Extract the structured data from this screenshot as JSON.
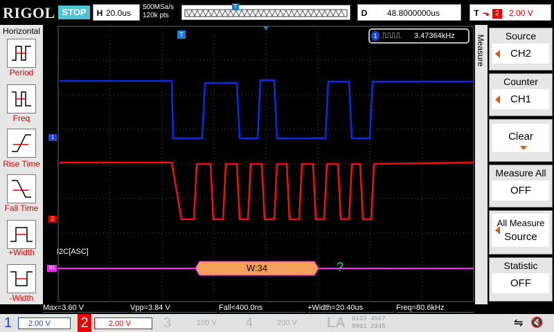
{
  "brand": "RIGOL",
  "run_state": "STOP",
  "horizontal": {
    "letter": "H",
    "timebase": "20.0us",
    "sample_rate": "500MSa/s",
    "memory_depth": "120k pts"
  },
  "delay": {
    "letter": "D",
    "value": "48.8000000us"
  },
  "trigger": {
    "letter": "T",
    "channel": "2",
    "level": "2.00 V"
  },
  "left_menu": {
    "title": "Horizontal",
    "items": [
      {
        "label": "Period",
        "icon": "period-icon"
      },
      {
        "label": "Freq",
        "icon": "freq-icon"
      },
      {
        "label": "Rise Time",
        "icon": "rise-time-icon"
      },
      {
        "label": "Fall Time",
        "icon": "fall-time-icon"
      },
      {
        "label": "+Width",
        "icon": "positive-width-icon"
      },
      {
        "label": "-Width",
        "icon": "negative-width-icon"
      }
    ]
  },
  "counter_readout": {
    "channel": "1",
    "value": "3.47364kHz"
  },
  "markers": {
    "ch1": "1",
    "ch2": "2",
    "bus": "B1",
    "trigger_top": "T",
    "trigger_right": "T"
  },
  "decode": {
    "label": "I2C[ASC]",
    "packet": "W:34",
    "unknown": "?"
  },
  "right_menu": {
    "tab": "Measure",
    "source": {
      "title": "Source",
      "value": "CH2"
    },
    "counter": {
      "title": "Counter",
      "value": "CH1"
    },
    "clear": {
      "title": "Clear"
    },
    "measure_all": {
      "title": "Measure All",
      "value": "OFF"
    },
    "all_measure_source": {
      "title": "All Measure",
      "value": "Source"
    },
    "statistic": {
      "title": "Statistic",
      "value": "OFF"
    }
  },
  "measurements": [
    {
      "text": "Max=3.60 V",
      "color": "#2255ff"
    },
    {
      "text": "Vpp=3.84 V",
      "color": "#2255ff"
    },
    {
      "text": "Fall<400.0ns",
      "color": "#2255ff"
    },
    {
      "text": "+Width=20.40us",
      "color": "#2255ff"
    },
    {
      "text": "Freq=80.6kHz",
      "color": "#ff2222"
    }
  ],
  "channels": [
    {
      "num": "1",
      "scale": "2.00 V",
      "color": "#1a44d8"
    },
    {
      "num": "2",
      "scale": "2.00 V",
      "color": "#e00000"
    },
    {
      "num": "3",
      "scale": "100 V",
      "color": "#bbbbbb"
    },
    {
      "num": "4",
      "scale": "200 V",
      "color": "#bbbbbb"
    }
  ],
  "la": {
    "label": "LA",
    "row1": "0123 4567",
    "row2": "8901 2345"
  },
  "colors": {
    "ch1": "#0a2ce8",
    "ch2": "#ee1111",
    "bus": "#ff22ff",
    "packet": "#f4a05a",
    "accent": "#4fc3d6"
  }
}
